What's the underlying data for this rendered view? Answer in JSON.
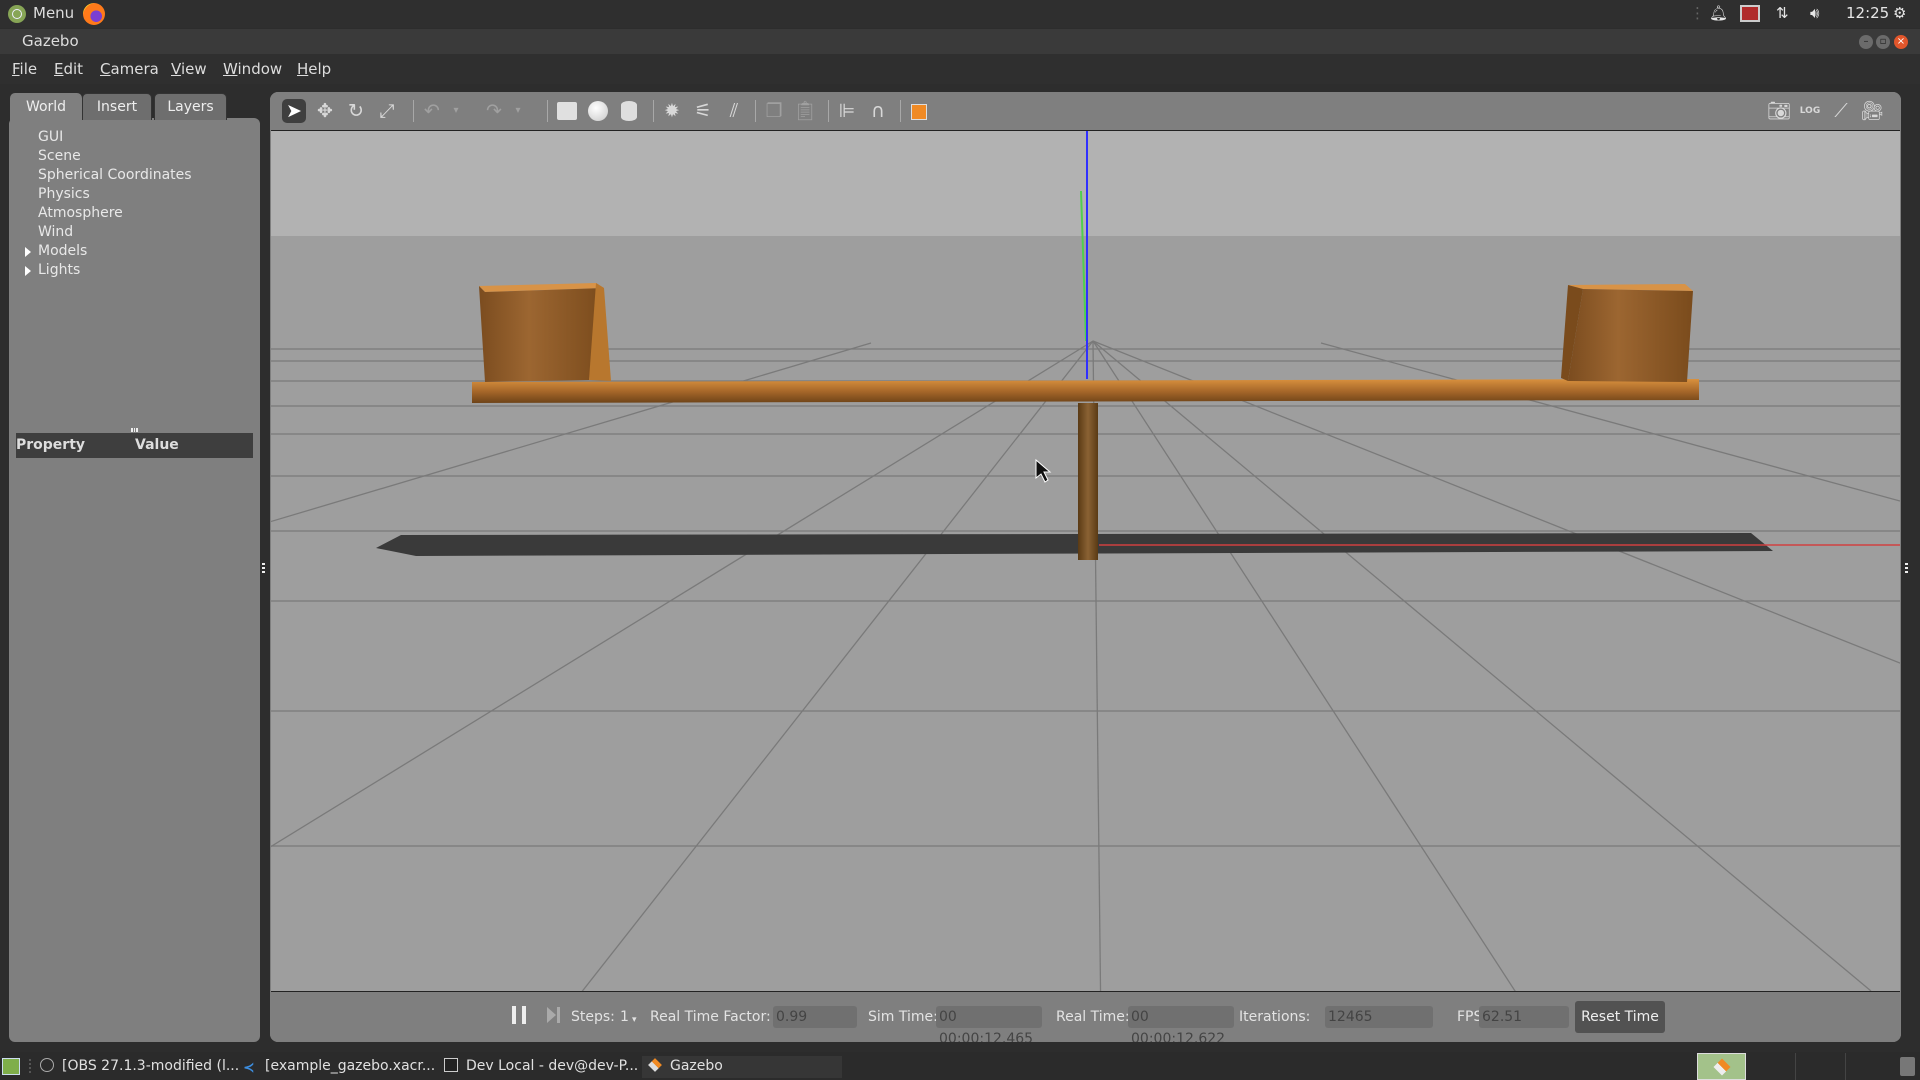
{
  "topbar": {
    "menu_label": "Menu",
    "clock": "12:25",
    "tray_icons": [
      "notification-bell-icon",
      "record-icon",
      "network-arrows-icon",
      "volume-icon",
      "power-gear-icon"
    ]
  },
  "window": {
    "title": "Gazebo"
  },
  "menubar": [
    "File",
    "Edit",
    "Camera",
    "View",
    "Window",
    "Help"
  ],
  "left_panel": {
    "tabs": [
      {
        "label": "World",
        "active": true
      },
      {
        "label": "Insert",
        "active": false
      },
      {
        "label": "Layers",
        "active": false
      }
    ],
    "tree": [
      {
        "label": "GUI",
        "expandable": false
      },
      {
        "label": "Scene",
        "expandable": false
      },
      {
        "label": "Spherical Coordinates",
        "expandable": false
      },
      {
        "label": "Physics",
        "expandable": false
      },
      {
        "label": "Atmosphere",
        "expandable": false
      },
      {
        "label": "Wind",
        "expandable": false
      },
      {
        "label": "Models",
        "expandable": true
      },
      {
        "label": "Lights",
        "expandable": true
      }
    ],
    "property_header": {
      "property": "Property",
      "value": "Value"
    }
  },
  "toolbar": {
    "left_tools": [
      "select-arrow-icon",
      "translate-icon",
      "rotate-icon",
      "scale-icon",
      "undo-icon",
      "redo-icon",
      "box-icon",
      "sphere-icon",
      "cylinder-icon",
      "point-light-icon",
      "spot-light-icon",
      "directional-light-icon",
      "copy-icon",
      "paste-icon",
      "align-icon",
      "snap-magnet-icon",
      "view-angle-icon"
    ],
    "right_tools": [
      "screenshot-camera-icon",
      "log-download-icon",
      "plot-icon",
      "video-record-icon"
    ]
  },
  "scene": {
    "colors": {
      "sky": "#b2b2b2",
      "ground": "#9e9e9e",
      "wood": "#c07a2e",
      "shadow": "#3a3a3a",
      "axis_x": "#d04040",
      "axis_y": "#4fd04f",
      "axis_z": "#3030ff"
    }
  },
  "statusbar": {
    "steps_label": "Steps:",
    "steps_value": "1",
    "rtf_label": "Real Time Factor:",
    "rtf_value": "0.99",
    "sim_time_label": "Sim Time:",
    "sim_time_value": "00 00:00:12.465",
    "real_time_label": "Real Time:",
    "real_time_value": "00 00:00:12.622",
    "iterations_label": "Iterations:",
    "iterations_value": "12465",
    "fps_label": "FPS:",
    "fps_value": "62.51",
    "reset_label": "Reset Time"
  },
  "taskbar": {
    "tasks": [
      {
        "label": "[OBS 27.1.3-modified (l...",
        "icon": "obs-icon"
      },
      {
        "label": "[example_gazebo.xacr...",
        "icon": "vscode-icon"
      },
      {
        "label": "Dev Local - dev@dev-P...",
        "icon": "terminal-icon"
      },
      {
        "label": "Gazebo",
        "icon": "gazebo-icon"
      }
    ]
  }
}
